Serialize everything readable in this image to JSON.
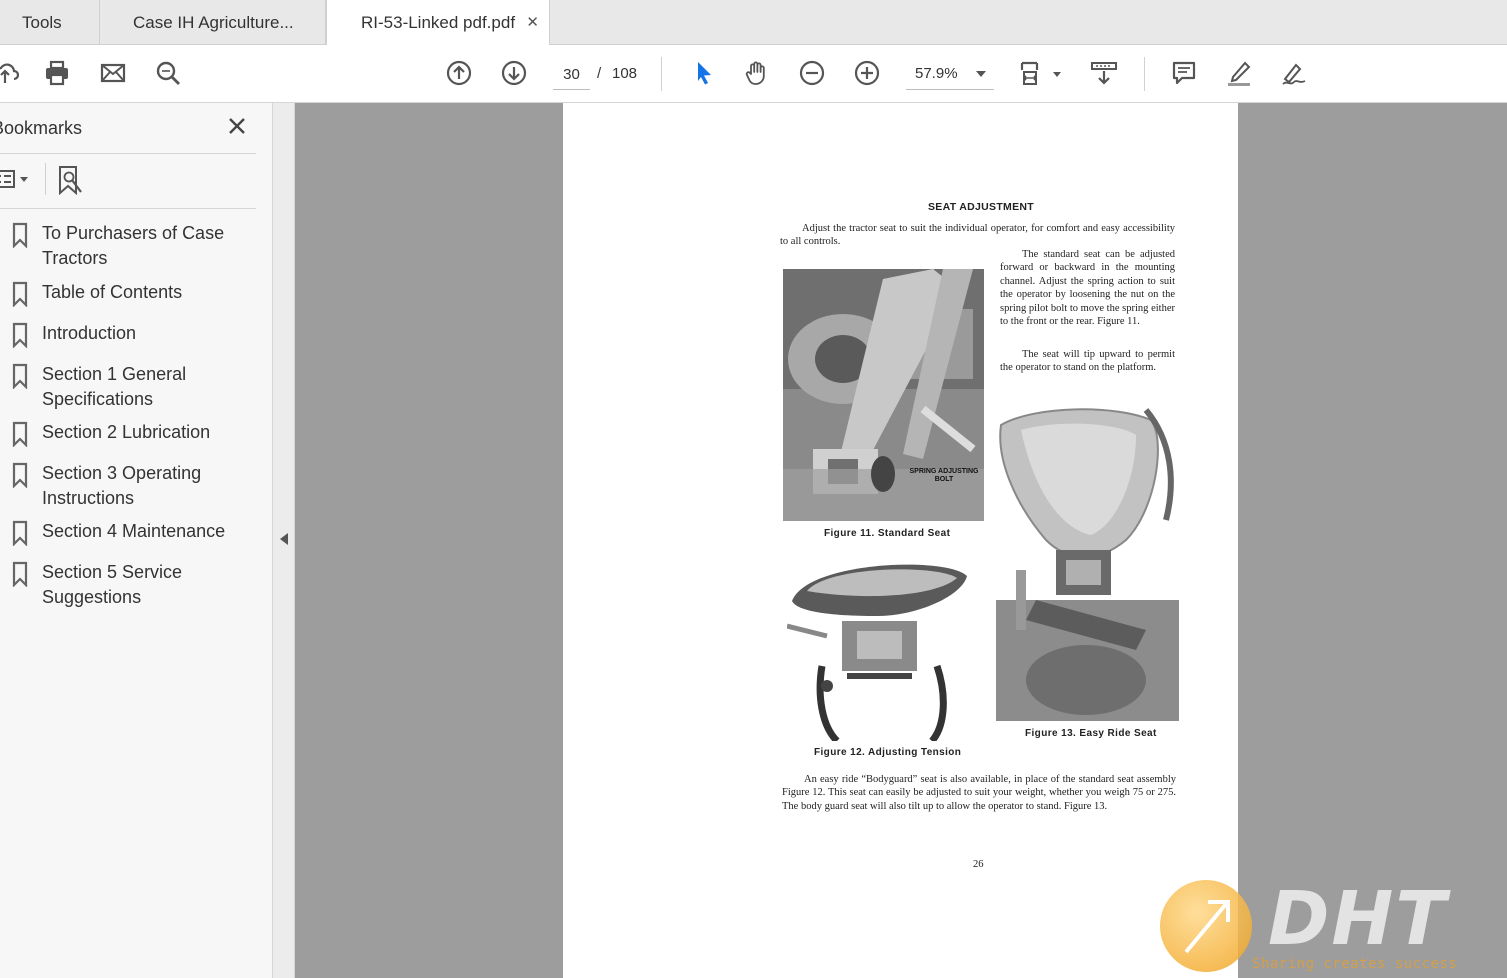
{
  "tabs": {
    "tools": "Tools",
    "doc1": "Case IH Agriculture...",
    "doc2": "RI-53-Linked pdf.pdf",
    "close": "✕"
  },
  "toolbar": {
    "current_page": "30",
    "page_separator": "/",
    "total_pages": "108",
    "zoom": "57.9%",
    "icons": [
      "upload-icon",
      "print-icon",
      "email-icon",
      "search-icon",
      "page-up-icon",
      "page-down-icon",
      "select-cursor-icon",
      "hand-icon",
      "zoom-out-icon",
      "zoom-in-icon",
      "fit-page-icon",
      "scroll-mode-icon",
      "comment-icon",
      "highlight-icon",
      "sign-icon"
    ],
    "accent_color": "#1473e6"
  },
  "sidebar": {
    "title": "Bookmarks",
    "items": [
      {
        "label": "To Purchasers of Case Tractors"
      },
      {
        "label": "Table of Contents"
      },
      {
        "label": "Introduction"
      },
      {
        "label": "Section 1 General Specifications"
      },
      {
        "label": "Section 2 Lubrication"
      },
      {
        "label": "Section 3 Operating Instructions"
      },
      {
        "label": "Section 4 Maintenance"
      },
      {
        "label": "Section 5 Service Suggestions"
      }
    ]
  },
  "document": {
    "heading": "SEAT ADJUSTMENT",
    "intro": "Adjust the tractor seat to suit the individual operator, for comfort and easy accessibility to all controls.",
    "standard_seat": "The standard seat can be adjusted forward or backward in the mounting channel. Adjust the spring action to suit the operator by loosening the nut on the spring pilot bolt to move the spring either to the front or the rear. Figure 11.",
    "tip_up": "The seat will tip upward to permit the operator to stand on the platform.",
    "photo_label": "SPRING ADJUSTING BOLT",
    "caption_11": "Figure 11. Standard Seat",
    "caption_12": "Figure 12. Adjusting Tension",
    "caption_13": "Figure 13. Easy Ride Seat",
    "bottom": "An easy ride “Bodyguard” seat is also available, in place of the standard seat assembly Figure 12. This seat can easily be adjusted to suit your weight, whether you weigh 75 or 275. The body guard seat will also tilt up to allow the operator to stand. Figure 13.",
    "page_number": "26"
  },
  "watermark": {
    "text": "DHT",
    "subtitle": "Sharing creates success"
  }
}
